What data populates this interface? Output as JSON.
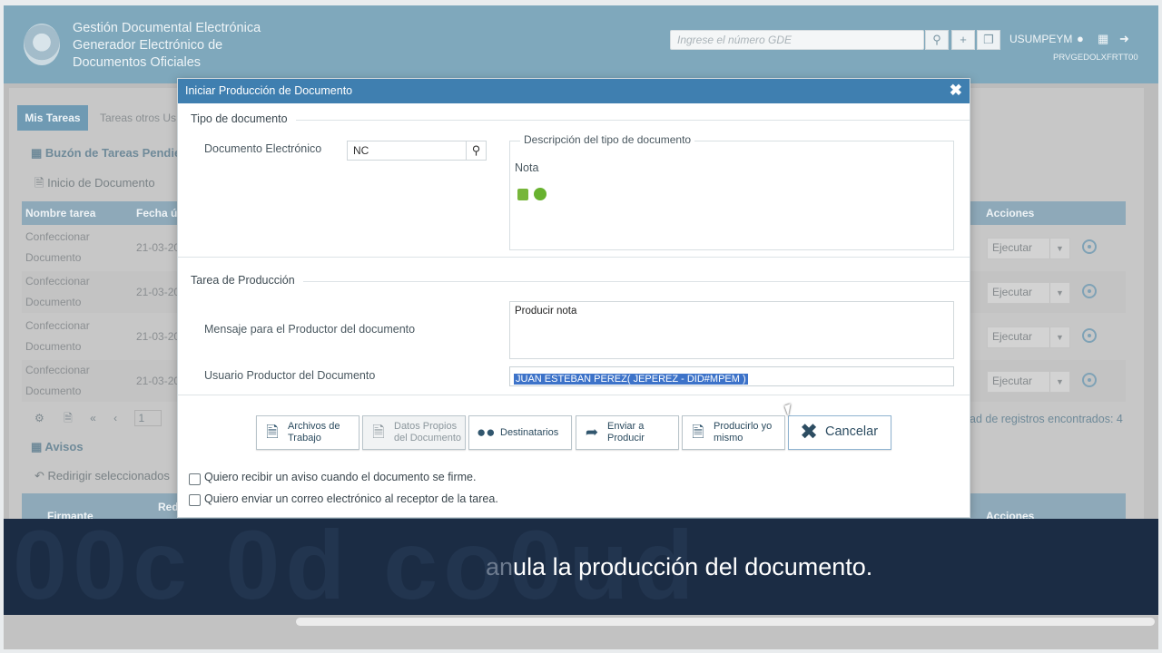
{
  "header": {
    "app_title_lines": [
      "Gestión Documental Electrónica",
      "Generador Electrónico de",
      "Documentos Oficiales"
    ],
    "search_placeholder": "Ingrese el número GDE",
    "username": "USUMPEYM",
    "org_code": "PRVGEDOLXFRTT00"
  },
  "background": {
    "tabs": [
      "Mis Tareas",
      "Tareas otros Us"
    ],
    "pending_section": "Buzón de Tareas Pendie",
    "start_doc": "Inicio de Documento",
    "columns": [
      "Nombre tarea",
      "Fecha úl",
      "Acciones"
    ],
    "rows": [
      {
        "name_l1": "Confeccionar",
        "name_l2": "Documento",
        "date": "21-03-20",
        "action": "Ejecutar"
      },
      {
        "name_l1": "Confeccionar",
        "name_l2": "Documento",
        "date": "21-03-20",
        "action": "Ejecutar"
      },
      {
        "name_l1": "Confeccionar",
        "name_l2": "Documento",
        "date": "21-03-20",
        "action": "Ejecutar"
      },
      {
        "name_l1": "Confeccionar",
        "name_l2": "Documento",
        "date": "21-03-20",
        "action": "Ejecutar"
      }
    ],
    "pager_page": "1",
    "records_text": "ad de registros encontrados: 4",
    "alerts_section": "Avisos",
    "redirect_label": "Redirigir seleccionados",
    "lower_table_partial": [
      "Firmante",
      "Red",
      "Acciones"
    ]
  },
  "modal": {
    "title": "Iniciar Producción de Documento",
    "doc_type_legend": "Tipo de documento",
    "doc_electronic_label": "Documento Electrónico",
    "doc_type_value": "NC",
    "description_legend": "Descripción del tipo de documento",
    "description_value": "Nota",
    "production_legend": "Tarea de Producción",
    "message_label": "Mensaje para el Productor del documento",
    "message_value": "Producir nota",
    "producer_label": "Usuario Productor del Documento",
    "producer_value": "JUAN ESTEBAN PEREZ( JEPEREZ - DID#MPEM )",
    "buttons": {
      "archivos": "Archivos de Trabajo",
      "datos": "Datos Propios del Documento",
      "destinatarios": "Destinatarios",
      "enviar": "Enviar a Producir",
      "producirlo": "Producirlo yo mismo",
      "cancelar": "Cancelar"
    },
    "checkbox_notify": "Quiero recibir un aviso cuando el documento se firme.",
    "checkbox_email": "Quiero enviar un correo electrónico al receptor de la tarea."
  },
  "subtitle": {
    "dim_part": "an",
    "main_part": "ula la producción del documento."
  },
  "colors": {
    "header_bg": "#7fa8bc",
    "modal_header": "#3f7fb0",
    "banner_bg": "#1b2c44",
    "selection": "#3d73c9"
  }
}
